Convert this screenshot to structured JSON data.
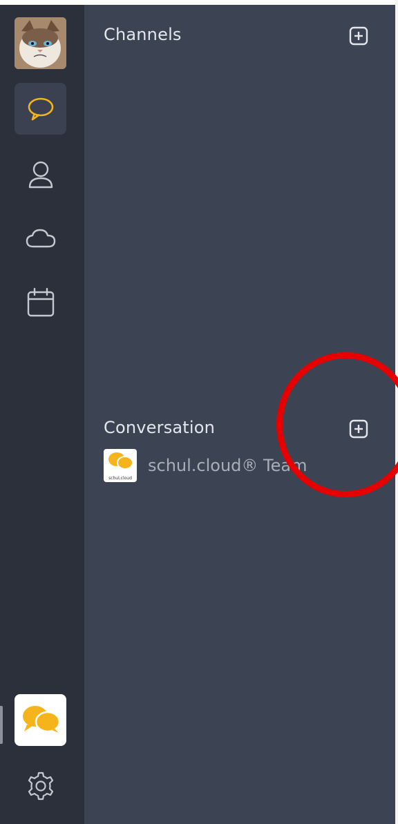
{
  "panel": {
    "channels_title": "Channels",
    "conversation_title": "Conversation"
  },
  "conversations": [
    {
      "name": "schul.cloud® Team",
      "logo_text": "schul.cloud"
    }
  ],
  "icons": {
    "chat": "chat-bubble-icon",
    "contacts": "user-icon",
    "cloud": "cloud-icon",
    "calendar": "calendar-icon",
    "settings": "gear-icon",
    "add": "plus-square-icon"
  },
  "colors": {
    "accent": "#f5b41b",
    "rail_bg": "#2b303b",
    "panel_bg": "#3c4352",
    "annotation": "#e60000"
  }
}
